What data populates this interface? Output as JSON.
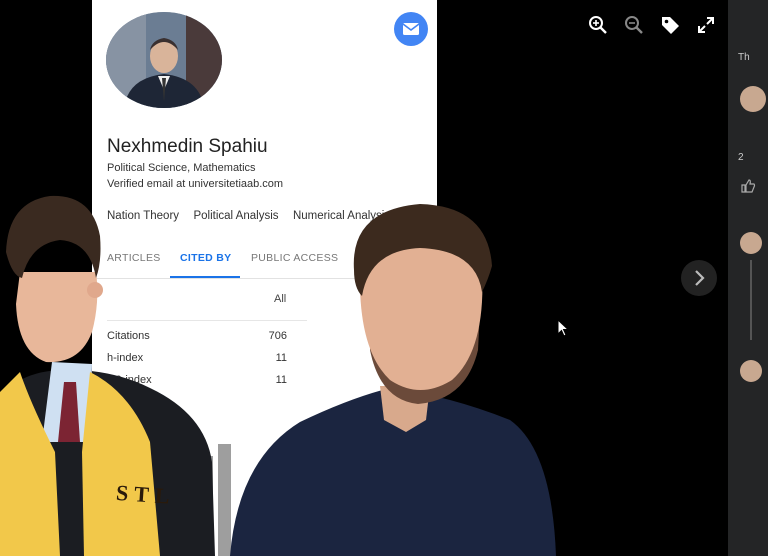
{
  "profile": {
    "name": "Nexhmedin Spahiu",
    "affiliation": "Political Science, Mathematics",
    "email": "Verified email at universitetiaab.com",
    "interests": [
      "Nation Theory",
      "Political Analysis",
      "Numerical Analysis"
    ]
  },
  "tabs": [
    "ARTICLES",
    "CITED BY",
    "PUBLIC ACCESS"
  ],
  "active_tab": "CITED BY",
  "cited_by": {
    "column": "All",
    "rows": [
      {
        "label": "Citations",
        "value": "706"
      },
      {
        "label": "h-index",
        "value": "11"
      },
      {
        "label": "i10-index",
        "value": "11"
      }
    ]
  },
  "sidebar": {
    "top_label": "Th",
    "like_count": "2"
  },
  "sash_text": "STL",
  "colors": {
    "accent": "#1a73e8",
    "email_button": "#4285f4",
    "sash": "#f2c84a",
    "viewer_bg": "#000000",
    "sidebar_bg": "#242526"
  },
  "icons": [
    "zoom-in-icon",
    "zoom-out-icon",
    "tag-icon",
    "fullscreen-icon",
    "email-icon",
    "chevron-right-icon",
    "mouse-cursor-icon",
    "like-icon"
  ]
}
